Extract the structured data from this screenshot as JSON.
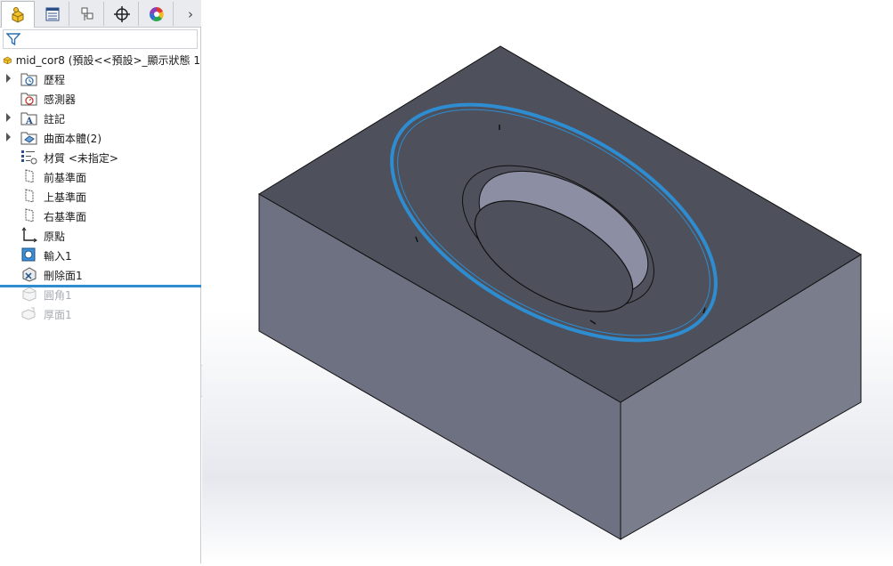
{
  "tabs": [
    {
      "name": "feature-manager",
      "icon": "part-tree-icon"
    },
    {
      "name": "property-manager",
      "icon": "property-list-icon"
    },
    {
      "name": "configuration-manager",
      "icon": "configuration-icon"
    },
    {
      "name": "dimxpert-manager",
      "icon": "crosshair-icon"
    },
    {
      "name": "display-manager",
      "icon": "color-wheel-icon"
    }
  ],
  "tab_more": "›",
  "filter": {
    "icon": "filter-icon",
    "value": ""
  },
  "root": {
    "label": "mid_cor8  (預設<<預設>_顯示狀態 1",
    "icon": "part-icon"
  },
  "tree": [
    {
      "label": "歷程",
      "icon": "history-folder-icon",
      "expandable": true,
      "disabled": false
    },
    {
      "label": "感測器",
      "icon": "sensor-folder-icon",
      "expandable": false,
      "disabled": false
    },
    {
      "label": "註記",
      "icon": "annotation-folder-icon",
      "expandable": true,
      "disabled": false
    },
    {
      "label": "曲面本體(2)",
      "icon": "surface-bodies-folder-icon",
      "expandable": true,
      "disabled": false
    },
    {
      "label": "材質 <未指定>",
      "icon": "material-icon",
      "expandable": false,
      "disabled": false
    },
    {
      "label": "前基準面",
      "icon": "plane-icon",
      "expandable": false,
      "disabled": false
    },
    {
      "label": "上基準面",
      "icon": "plane-icon",
      "expandable": false,
      "disabled": false
    },
    {
      "label": "右基準面",
      "icon": "plane-icon",
      "expandable": false,
      "disabled": false
    },
    {
      "label": "原點",
      "icon": "origin-icon",
      "expandable": false,
      "disabled": false
    },
    {
      "label": "輸入1",
      "icon": "import-feature-icon",
      "expandable": false,
      "disabled": false
    },
    {
      "label": "刪除面1",
      "icon": "delete-face-icon",
      "expandable": false,
      "disabled": false
    },
    {
      "label": "圓角1",
      "icon": "fillet-icon",
      "expandable": false,
      "disabled": true
    },
    {
      "label": "厚面1",
      "icon": "thicken-icon",
      "expandable": false,
      "disabled": true
    }
  ],
  "colors": {
    "accent": "#2e8dd1",
    "model_top": "#4d4f5a",
    "model_front": "#6d7080",
    "model_right": "#7a7d8c",
    "selection": "#2e8dd1"
  }
}
